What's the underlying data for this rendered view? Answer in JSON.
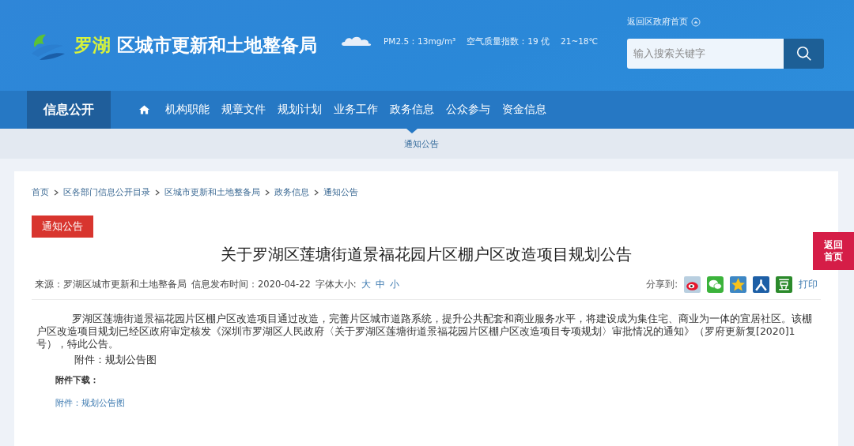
{
  "header": {
    "logo_accent": "罗湖",
    "logo_title": "区城市更新和土地整备局",
    "weather": "PM2.5：13mg/m³",
    "air_quality": "空气质量指数：19 优",
    "temperature": "21~18℃",
    "home_link": "返回区政府首页",
    "search": {
      "placeholder": "输入搜索关键字"
    }
  },
  "nav": {
    "section": "信息公开",
    "items": [
      {
        "label": "机构职能",
        "selected": false
      },
      {
        "label": "规章文件",
        "selected": false
      },
      {
        "label": "规划计划",
        "selected": false
      },
      {
        "label": "业务工作",
        "selected": false
      },
      {
        "label": "政务信息",
        "selected": true
      },
      {
        "label": "公众参与",
        "selected": false
      },
      {
        "label": "资金信息",
        "selected": false
      }
    ],
    "sub_items": [
      "通知公告"
    ]
  },
  "breadcrumb": [
    "首页",
    "区各部门信息公开目录",
    "区城市更新和土地整备局",
    "政务信息",
    "通知公告"
  ],
  "article": {
    "category": "通知公告",
    "title": "关于罗湖区莲塘街道景福花园片区棚户区改造项目规划公告",
    "source": "来源：罗湖区城市更新和土地整备局",
    "date": "信息发布时间：2020-04-22",
    "font_size_label": "字体大小:",
    "font_sizes": [
      "大",
      "中",
      "小"
    ],
    "share_label": "分享到:",
    "share_targets": [
      {
        "kind": "weibo"
      },
      {
        "kind": "wechat"
      },
      {
        "kind": "qzone"
      },
      {
        "kind": "renren"
      },
      {
        "kind": "douban"
      }
    ],
    "print": "打印",
    "body": "罗湖区莲塘街道景福花园片区棚户区改造项目通过改造，完善片区城市道路系统，提升公共配套和商业服务水平，将建设成为集住宅、商业为一体的宜居社区。该棚户区改造项目规划已经区政府审定核发《深圳市罗湖区人民政府〈关于罗湖区莲塘街道景福花园片区棚户区改造项目专项规划〉审批情况的通知》（罗府更新复[2020]1号），特此公告。",
    "attachment_note": "附件：规划公告图",
    "download_label": "附件下载：",
    "download_link": "附件：规划公告图"
  },
  "side_button": "返回首页"
}
